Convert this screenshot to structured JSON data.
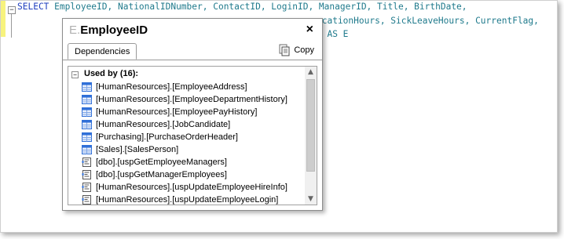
{
  "editor": {
    "lines": [
      {
        "keyword": "SELECT",
        "text": " EmployeeID, NationalIDNumber, ContactID, LoginID, ManagerID, Title, BirthDate,"
      },
      {
        "keyword": "",
        "text": "acationHours, SickLeaveHours, CurrentFlag,"
      },
      {
        "keyword": "",
        "text": "e AS E"
      }
    ]
  },
  "popup": {
    "title_prefix": "E.",
    "title_name": "EmployeeID",
    "close_glyph": "×",
    "tab_label": "Dependencies",
    "copy_label": "Copy",
    "root_label": "Used by (16):",
    "items": [
      {
        "icon": "table-icon",
        "label": "[HumanResources].[EmployeeAddress]"
      },
      {
        "icon": "table-icon",
        "label": "[HumanResources].[EmployeeDepartmentHistory]"
      },
      {
        "icon": "table-icon",
        "label": "[HumanResources].[EmployeePayHistory]"
      },
      {
        "icon": "table-icon",
        "label": "[HumanResources].[JobCandidate]"
      },
      {
        "icon": "table-icon",
        "label": "[Purchasing].[PurchaseOrderHeader]"
      },
      {
        "icon": "table-icon",
        "label": "[Sales].[SalesPerson]"
      },
      {
        "icon": "procedure-icon",
        "label": "[dbo].[uspGetEmployeeManagers]"
      },
      {
        "icon": "procedure-icon",
        "label": "[dbo].[uspGetManagerEmployees]"
      },
      {
        "icon": "procedure-icon",
        "label": "[HumanResources].[uspUpdateEmployeeHireInfo]"
      },
      {
        "icon": "procedure-icon",
        "label": "[HumanResources].[uspUpdateEmployeeLogin]"
      }
    ]
  },
  "colors": {
    "code_identifier": "#1f7a8c",
    "code_keyword": "#1f3fbf",
    "gutter_marker": "#f7f37e",
    "table_icon_blue": "#2f6fd8"
  }
}
